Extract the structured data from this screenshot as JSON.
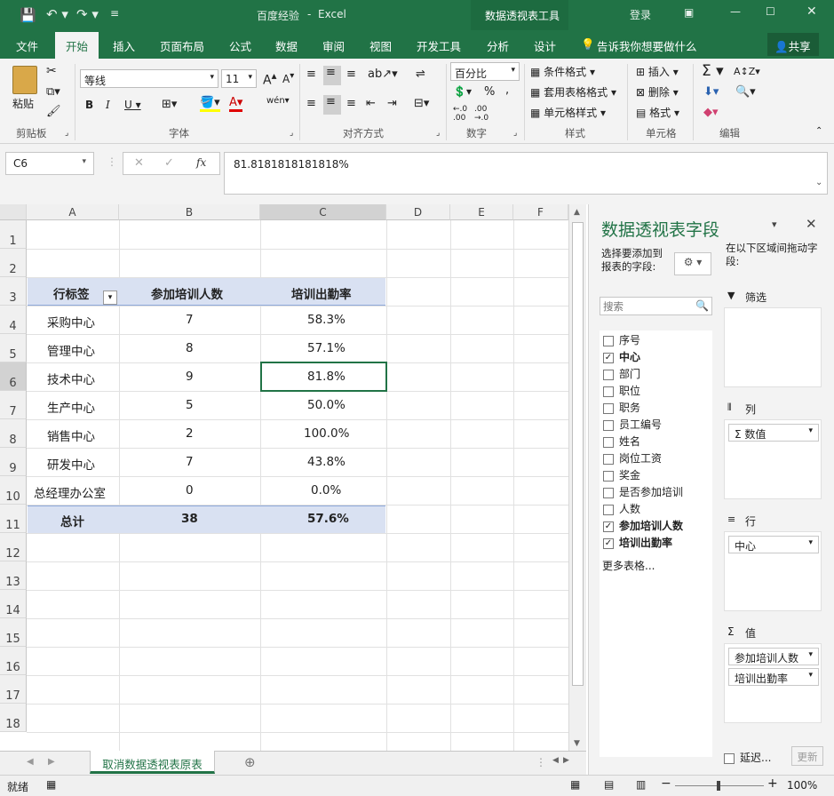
{
  "titlebar": {
    "doc_title": "百度经验",
    "sep": "-",
    "app": "Excel",
    "context_tool": "数据透视表工具",
    "login": "登录"
  },
  "tabs": [
    "文件",
    "开始",
    "插入",
    "页面布局",
    "公式",
    "数据",
    "审阅",
    "视图",
    "开发工具",
    "分析",
    "设计"
  ],
  "tell_me": "告诉我你想要做什么",
  "share": "共享",
  "ribbon": {
    "paste": "粘贴",
    "font_name": "等线",
    "font_size": "11",
    "number_format": "百分比",
    "cond_format": "条件格式",
    "table_format": "套用表格格式",
    "cell_style": "单元格样式",
    "insert": "插入",
    "delete": "删除",
    "format": "格式",
    "groups": [
      "剪贴板",
      "字体",
      "对齐方式",
      "数字",
      "样式",
      "单元格",
      "编辑"
    ]
  },
  "formula": {
    "cell_ref": "C6",
    "value": "81.8181818181818%",
    "fx": "fx"
  },
  "columns": [
    "A",
    "B",
    "C",
    "D",
    "E",
    "F"
  ],
  "rows": [
    "1",
    "2",
    "3",
    "4",
    "5",
    "6",
    "7",
    "8",
    "9",
    "10",
    "11",
    "12",
    "13",
    "14",
    "15",
    "16",
    "17",
    "18"
  ],
  "pivot": {
    "headers": [
      "行标签",
      "参加培训人数",
      "培训出勤率"
    ],
    "rows": [
      [
        "采购中心",
        "7",
        "58.3%"
      ],
      [
        "管理中心",
        "8",
        "57.1%"
      ],
      [
        "技术中心",
        "9",
        "81.8%"
      ],
      [
        "生产中心",
        "5",
        "50.0%"
      ],
      [
        "销售中心",
        "2",
        "100.0%"
      ],
      [
        "研发中心",
        "7",
        "43.8%"
      ],
      [
        "总经理办公室",
        "0",
        "0.0%"
      ]
    ],
    "total": [
      "总计",
      "38",
      "57.6%"
    ]
  },
  "sheet_tab": "取消数据透视表原表",
  "status": {
    "ready": "就绪",
    "zoom": "100%"
  },
  "pane": {
    "title": "数据透视表字段",
    "choose": "选择要添加到报表的字段:",
    "drag": "在以下区域间拖动字段:",
    "search_placeholder": "搜索",
    "fields": [
      {
        "label": "序号",
        "checked": false
      },
      {
        "label": "中心",
        "checked": true
      },
      {
        "label": "部门",
        "checked": false
      },
      {
        "label": "职位",
        "checked": false
      },
      {
        "label": "职务",
        "checked": false
      },
      {
        "label": "员工编号",
        "checked": false
      },
      {
        "label": "姓名",
        "checked": false
      },
      {
        "label": "岗位工资",
        "checked": false
      },
      {
        "label": "奖金",
        "checked": false
      },
      {
        "label": "是否参加培训",
        "checked": false
      },
      {
        "label": "人数",
        "checked": false
      },
      {
        "label": "参加培训人数",
        "checked": true
      },
      {
        "label": "培训出勤率",
        "checked": true
      }
    ],
    "more_tables": "更多表格...",
    "filter": "筛选",
    "columns": "列",
    "rows": "行",
    "values": "值",
    "col_item": "数值",
    "row_item": "中心",
    "value_items": [
      "参加培训人数",
      "培训出勤率"
    ],
    "defer": "延迟...",
    "update": "更新"
  }
}
